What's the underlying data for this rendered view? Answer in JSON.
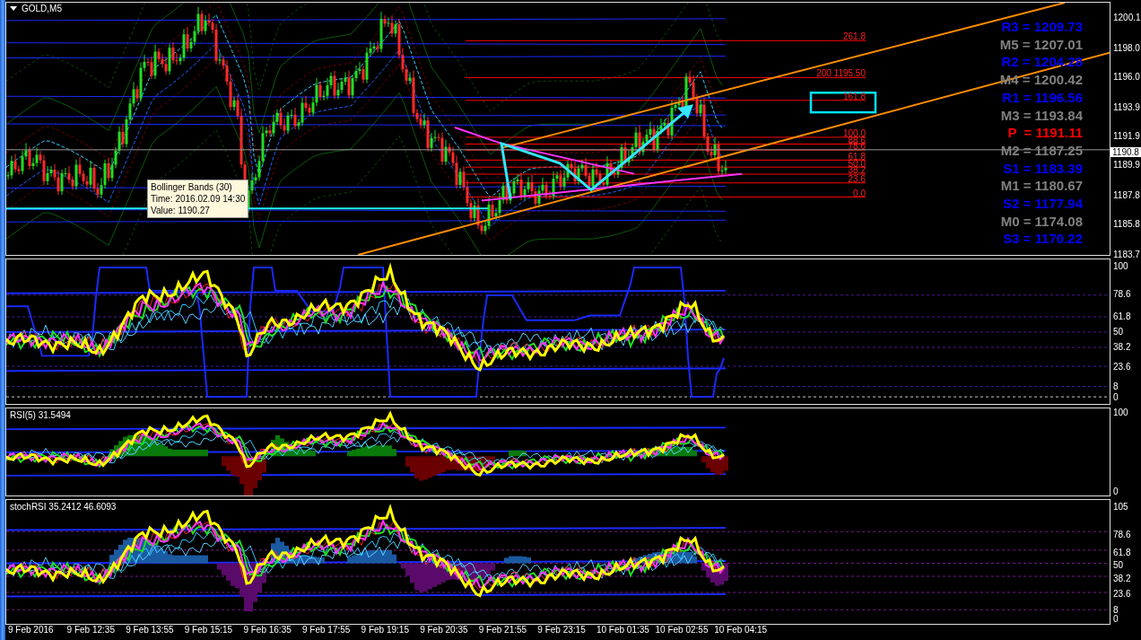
{
  "chart": {
    "title": "GOLD,M5"
  },
  "main_pane": {
    "price_axis": [
      "1200.1",
      "1198.0",
      "1196.0",
      "1193.9",
      "1191.9",
      "1189.9",
      "1187.8",
      "1185.8",
      "1183.7"
    ],
    "current_price": "1190.8",
    "tooltip": [
      "Bollinger Bands (30)",
      "Time: 2016.02.09 14:30",
      "Value: 1190.27"
    ],
    "fib_levels": [
      "261.8",
      "200 1195.50",
      "161.8",
      "100.0",
      "88.6",
      "78.6",
      "61.8",
      "50.0",
      "38.2",
      "23.6",
      "0.0"
    ],
    "pivots": [
      {
        "label": "R3 = 1209.73",
        "color": "#0000ff"
      },
      {
        "label": "M5 = 1207.01",
        "color": "#808080"
      },
      {
        "label": "R2 = 1204.28",
        "color": "#0000ff"
      },
      {
        "label": "M4 = 1200.42",
        "color": "#808080"
      },
      {
        "label": "R1 = 1196.56",
        "color": "#0000ff"
      },
      {
        "label": "M3 = 1193.84",
        "color": "#808080"
      },
      {
        "label": "P  = 1191.11",
        "color": "#ff0000"
      },
      {
        "label": "M2 = 1187.25",
        "color": "#808080"
      },
      {
        "label": "S1 = 1183.39",
        "color": "#0000ff"
      },
      {
        "label": "M1 = 1180.67",
        "color": "#808080"
      },
      {
        "label": "S2 = 1177.94",
        "color": "#0000ff"
      },
      {
        "label": "M0 = 1174.08",
        "color": "#808080"
      },
      {
        "label": "S3 = 1170.22",
        "color": "#0000ff"
      }
    ]
  },
  "indicator_panes": [
    {
      "kind": "oscillator",
      "axis": [
        "100",
        "78.6",
        "61.8",
        "50",
        "38.2",
        "23.6",
        "8",
        "0"
      ]
    },
    {
      "kind": "rsi",
      "title": "RSI(5) 31.5494",
      "axis": [
        "100",
        "0"
      ]
    },
    {
      "kind": "stoch",
      "title": "stochRSI 35.2412 46.6093",
      "axis": [
        "105",
        "78.6",
        "61.8",
        "50",
        "38.2",
        "23.6",
        "8",
        "0"
      ]
    }
  ],
  "time_axis": [
    "9 Feb 2016",
    "9 Feb 12:35",
    "9 Feb 13:55",
    "9 Feb 15:15",
    "9 Feb 16:35",
    "9 Feb 17:55",
    "9 Feb 19:15",
    "9 Feb 20:35",
    "9 Feb 21:55",
    "9 Feb 23:15",
    "10 Feb 01:35",
    "10 Feb 02:55",
    "10 Feb 04:15"
  ]
}
